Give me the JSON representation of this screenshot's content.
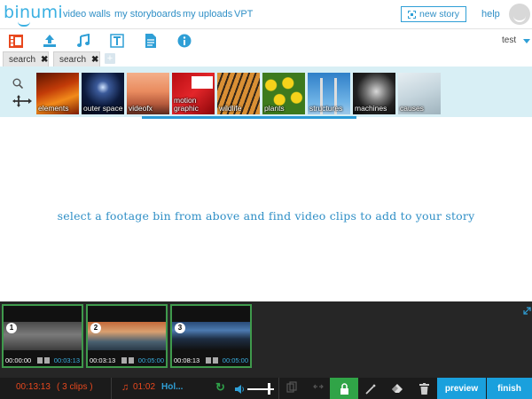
{
  "nav": {
    "logo": "binumi",
    "links": [
      "video walls",
      "my storyboards",
      "my uploads",
      "VPT"
    ],
    "new_story": "new story",
    "help": "help",
    "user": "test"
  },
  "toolbar": {
    "icons": [
      "film-icon",
      "upload-icon",
      "music-icon",
      "text-icon",
      "document-icon",
      "info-icon"
    ]
  },
  "tabs": [
    {
      "label": "search"
    },
    {
      "label": "search"
    }
  ],
  "bins": [
    {
      "label": "elements"
    },
    {
      "label": "outer space"
    },
    {
      "label": "videofx"
    },
    {
      "label": "motion graphic"
    },
    {
      "label": "wildlife"
    },
    {
      "label": "plants"
    },
    {
      "label": "structures"
    },
    {
      "label": "machines"
    },
    {
      "label": "causes"
    }
  ],
  "main": {
    "message": "select a footage bin from above and find video clips to add to your story"
  },
  "timeline": {
    "clips": [
      {
        "num": "1",
        "in": "00:00:00",
        "out": "00:03:13"
      },
      {
        "num": "2",
        "in": "00:03:13",
        "out": "00:05:00"
      },
      {
        "num": "3",
        "in": "00:08:13",
        "out": "00:05:00"
      }
    ]
  },
  "bottom": {
    "duration": "00:13:13",
    "clip_count": "( 3 clips )",
    "music_time": "01:02",
    "music_title": "Hol...",
    "preview": "preview",
    "finish": "finish"
  },
  "colors": {
    "accent": "#2f8fc6",
    "bin_strip": "#d8eff5",
    "timeline_bg": "#262626",
    "clip_border": "#3f9a4c",
    "orange": "#e8481e",
    "button_blue": "#1aa0dd",
    "lock_green": "#30a447"
  }
}
